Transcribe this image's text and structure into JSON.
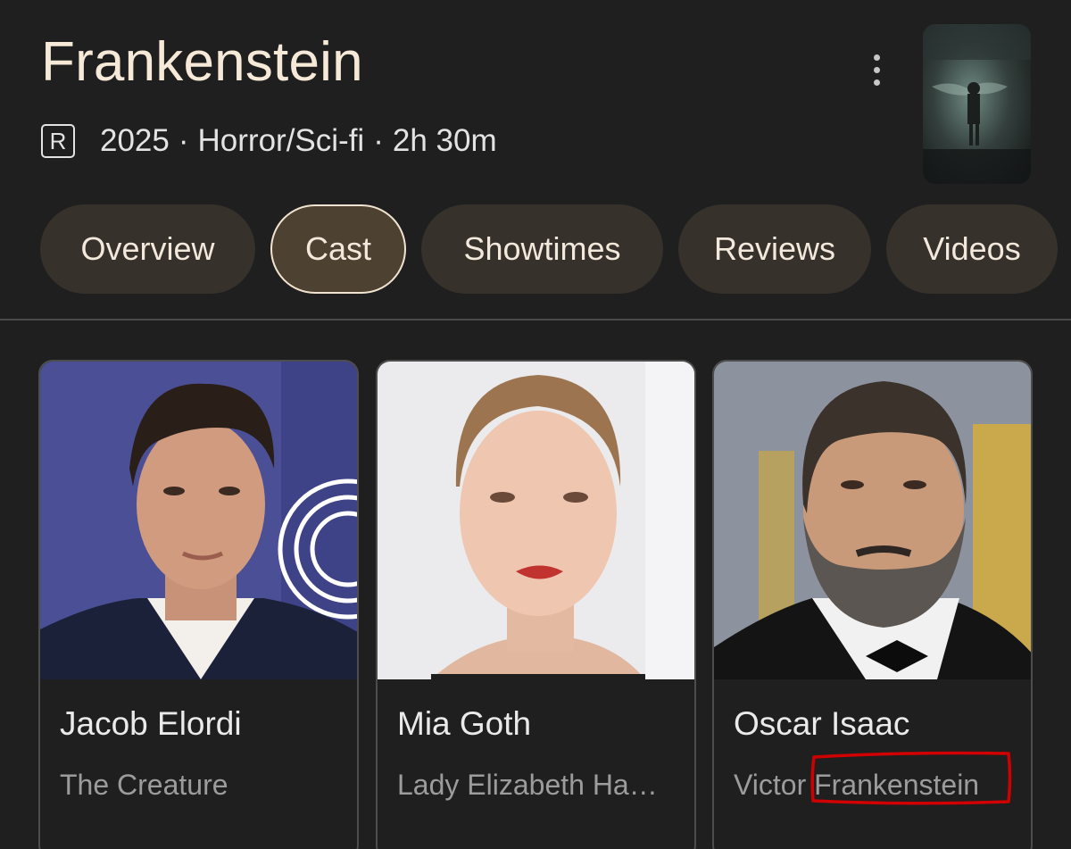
{
  "header": {
    "title": "Frankenstein",
    "rating": "R",
    "year": "2025",
    "genre": "Horror/Sci-fi",
    "runtime": "2h 30m",
    "separator": "·"
  },
  "tabs": [
    {
      "label": "Overview",
      "active": false
    },
    {
      "label": "Cast",
      "active": true
    },
    {
      "label": "Showtimes",
      "active": false
    },
    {
      "label": "Reviews",
      "active": false
    },
    {
      "label": "Videos",
      "active": false
    }
  ],
  "cast": [
    {
      "name": "Jacob Elordi",
      "role": "The Creature"
    },
    {
      "name": "Mia Goth",
      "role": "Lady Elizabeth Ha…"
    },
    {
      "name": "Oscar Isaac",
      "role": "Victor Frankenstein"
    }
  ],
  "colors": {
    "background": "#1f1f1f",
    "title": "#f6e9d8",
    "tab_bg": "#36312b",
    "tab_active_bg": "#4d4232",
    "annotation": "#d10000"
  },
  "icons": {
    "more": "more-vert-icon",
    "rating": "rating-badge"
  }
}
